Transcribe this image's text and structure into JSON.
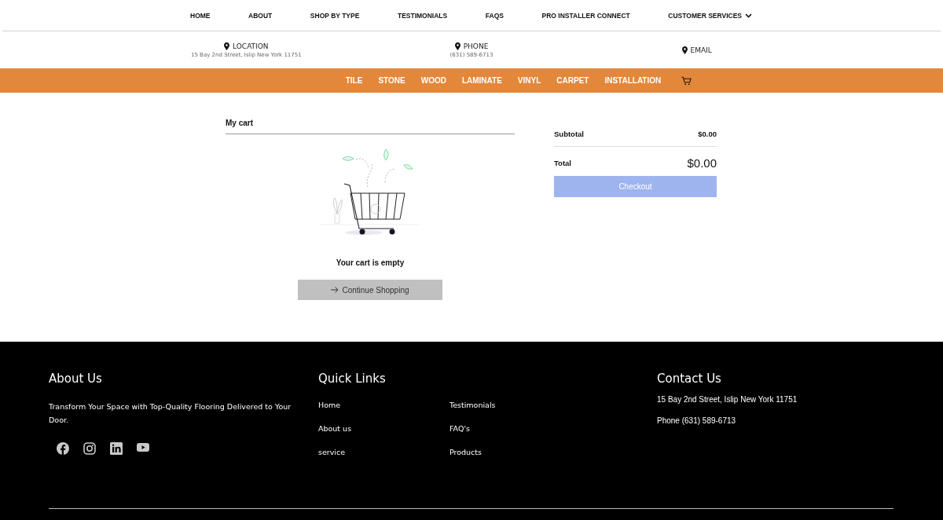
{
  "top_nav": {
    "items": [
      {
        "label": "HOME",
        "dropdown": false
      },
      {
        "label": "ABOUT",
        "dropdown": false
      },
      {
        "label": "SHOP BY TYPE",
        "dropdown": false
      },
      {
        "label": "TESTIMONIALS",
        "dropdown": false
      },
      {
        "label": "FAQS",
        "dropdown": false
      },
      {
        "label": "PRO INSTALLER CONNECT",
        "dropdown": false
      },
      {
        "label": "CUSTOMER SERVICES",
        "dropdown": true
      }
    ]
  },
  "contact_bar": [
    {
      "label": "LOCATION",
      "detail": "15 Bay 2nd Street, Islip New York 11751"
    },
    {
      "label": "PHONE",
      "detail": "(631) 589-6713"
    },
    {
      "label": "EMAIL"
    }
  ],
  "category_bar": {
    "items": [
      "TILE",
      "STONE",
      "WOOD",
      "LAMINATE",
      "VINYL",
      "CARPET",
      "INSTALLATION"
    ]
  },
  "cart": {
    "title": "My cart",
    "empty_message": "Your cart is empty",
    "continue_button": "Continue Shopping"
  },
  "summary": {
    "subtotal_label": "Subtotal",
    "subtotal": "$0.00",
    "total_label": "Total",
    "total": "$0.00",
    "checkout": {
      "label": "Checkout",
      "disabled": true
    }
  },
  "footer": {
    "about": {
      "title": "About Us",
      "text": "Transform Your Space with Top-Quality Flooring Delivered to Your Door."
    },
    "quick_links": {
      "title": "Quick Links",
      "links": [
        "Home",
        "Testimonials",
        "About us",
        "FAQ's",
        "service",
        "Products"
      ]
    },
    "contact": {
      "title": "Contact Us",
      "lines": [
        "15 Bay 2nd Street, Islip New York 11751",
        "Phone (631) 589-6713"
      ]
    }
  }
}
